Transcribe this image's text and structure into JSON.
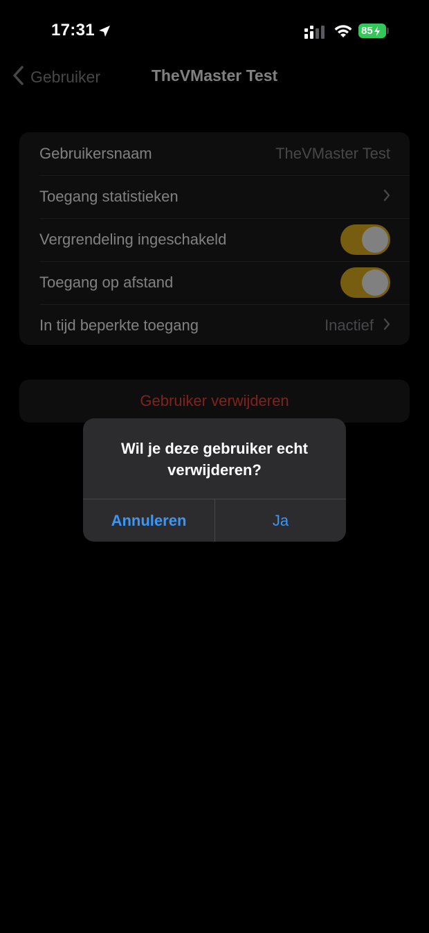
{
  "status_bar": {
    "time": "17:31",
    "battery_level": "85",
    "icons": [
      "location-arrow-icon",
      "cellular-signal-icon",
      "wifi-icon",
      "battery-charging-icon"
    ]
  },
  "nav": {
    "back_label": "Gebruiker",
    "title": "TheVMaster Test"
  },
  "settings": {
    "username": {
      "label": "Gebruikersnaam",
      "value": "TheVMaster Test"
    },
    "stats_access": {
      "label": "Toegang statistieken"
    },
    "lock_enabled": {
      "label": "Vergrendeling ingeschakeld",
      "on": true
    },
    "remote_access": {
      "label": "Toegang op afstand",
      "on": true
    },
    "timed_access": {
      "label": "In tijd beperkte toegang",
      "value": "Inactief"
    }
  },
  "delete": {
    "label": "Gebruiker verwijderen"
  },
  "alert": {
    "title": "Wil je deze gebruiker echt verwijderen?",
    "cancel_label": "Annuleren",
    "confirm_label": "Ja"
  },
  "colors": {
    "background": "#000000",
    "group_background": "#1c1c1e",
    "alert_background": "#2c2c2e",
    "toggle_on": "#ecb91f",
    "destructive": "#ff453a",
    "action_blue": "#3e96f4",
    "battery_green": "#34c759"
  }
}
